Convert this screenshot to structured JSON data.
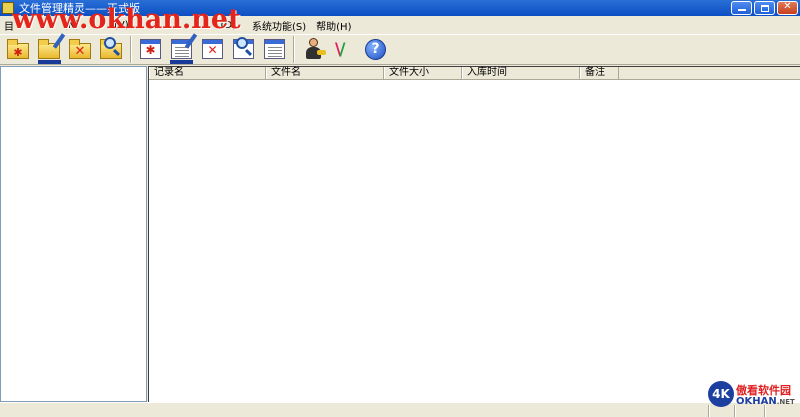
{
  "window": {
    "title": "文件管理精灵——正式版",
    "controls": {
      "minimize": "",
      "maximize": "",
      "close": "✕"
    }
  },
  "menubar": {
    "items": [
      "目",
      "(N)",
      "(V)",
      "(D)",
      "系统功能(S)",
      "帮助(H)"
    ]
  },
  "toolbar": {
    "buttons": [
      {
        "icon": "new-folder-icon"
      },
      {
        "icon": "edit-folder-icon"
      },
      {
        "icon": "delete-folder-icon"
      },
      {
        "icon": "search-folder-icon"
      },
      {
        "icon": "new-record-icon"
      },
      {
        "icon": "edit-record-icon"
      },
      {
        "icon": "delete-record-icon"
      },
      {
        "icon": "find-record-icon"
      },
      {
        "icon": "print-record-icon"
      },
      {
        "icon": "user-key-icon"
      },
      {
        "icon": "logo-icon"
      },
      {
        "icon": "help-icon",
        "glyph": "?"
      }
    ]
  },
  "listview": {
    "columns": [
      "记录名",
      "文件名",
      "文件大小",
      "入库时间",
      "备注"
    ]
  },
  "watermarks": {
    "top": "www.okhan.net",
    "badge": "4K",
    "cn": "傲看软件园",
    "en": "OKHAN",
    "en_suffix": ".NET"
  },
  "colors": {
    "titlebar": "#0b4fc4",
    "watermark_red": "#e3251b",
    "brand_blue": "#1d3fa0"
  }
}
